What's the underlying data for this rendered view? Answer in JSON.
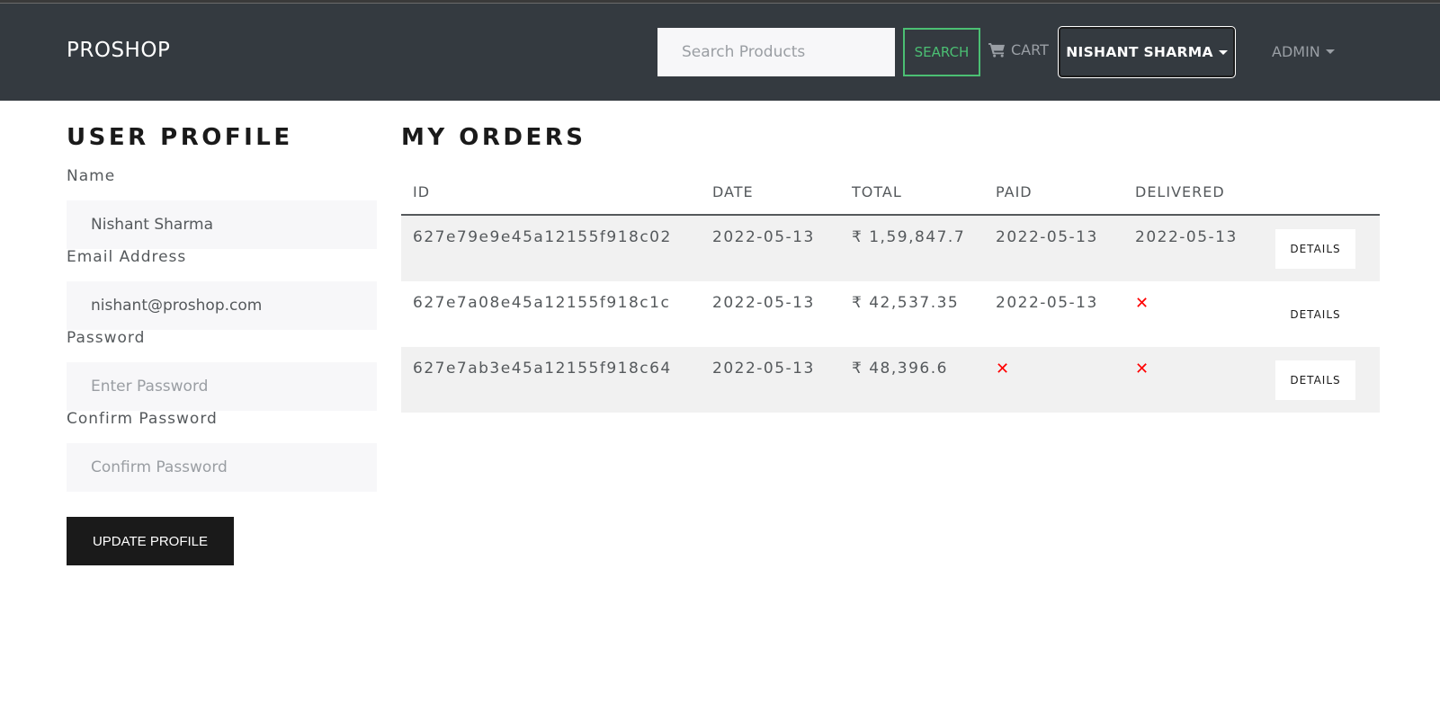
{
  "navbar": {
    "brand": "PROSHOP",
    "search_placeholder": "Search Products",
    "search_value": "",
    "search_button": "SEARCH",
    "cart_label": "CART",
    "user_menu": "NISHANT SHARMA",
    "admin_menu": "ADMIN"
  },
  "profile": {
    "title": "USER PROFILE",
    "name_label": "Name",
    "name_value": "Nishant Sharma",
    "email_label": "Email Address",
    "email_value": "nishant@proshop.com",
    "password_label": "Password",
    "password_placeholder": "Enter Password",
    "confirm_label": "Confirm Password",
    "confirm_placeholder": "Confirm Password",
    "update_button": "UPDATE PROFILE"
  },
  "orders": {
    "title": "MY ORDERS",
    "columns": [
      "ID",
      "DATE",
      "TOTAL",
      "PAID",
      "DELIVERED"
    ],
    "details_label": "DETAILS",
    "not_done_icon": "✕",
    "rows": [
      {
        "id": "627e79e9e45a12155f918c02",
        "date": "2022-05-13",
        "total": "₹ 1,59,847.7",
        "paid": "2022-05-13",
        "delivered": "2022-05-13"
      },
      {
        "id": "627e7a08e45a12155f918c1c",
        "date": "2022-05-13",
        "total": "₹ 42,537.35",
        "paid": "2022-05-13",
        "delivered": null
      },
      {
        "id": "627e7ab3e45a12155f918c64",
        "date": "2022-05-13",
        "total": "₹ 48,396.6",
        "paid": null,
        "delivered": null
      }
    ]
  },
  "colors": {
    "navbar_bg": "#343a40",
    "success": "#4bbf73",
    "danger": "#ff0000",
    "dark_button": "#1a1a1a"
  }
}
